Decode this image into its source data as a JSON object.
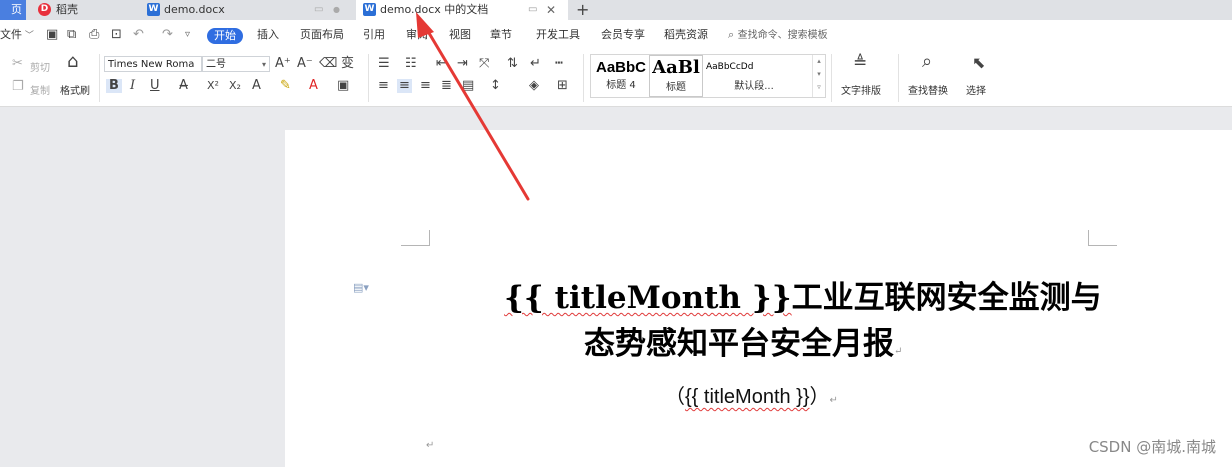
{
  "tabs": [
    {
      "label": "页",
      "icon": "home-icon"
    },
    {
      "label": "稻壳",
      "icon": "docer-icon"
    },
    {
      "label": "demo.docx",
      "icon": "word-doc-icon"
    },
    {
      "label": "demo.docx 中的文档",
      "icon": "word-doc-icon"
    }
  ],
  "menu": {
    "file": "文件",
    "start": "开始",
    "items": [
      "插入",
      "页面布局",
      "引用",
      "审阅",
      "视图",
      "章节",
      "开发工具",
      "会员专享",
      "稻壳资源"
    ],
    "search_placeholder": "查找命令、搜索模板"
  },
  "ribbon": {
    "cut": "剪切",
    "copy": "复制",
    "format_painter": "格式刷",
    "font_name": "Times New Roma",
    "font_size": "二号",
    "styles": [
      {
        "preview": "AaBbC",
        "name": "标题 4"
      },
      {
        "preview": "AaBl",
        "name": "标题"
      },
      {
        "preview": "AaBbCcDd",
        "name": "默认段..."
      }
    ],
    "text_layout": "文字排版",
    "find_replace": "查找替换",
    "select": "选择"
  },
  "document": {
    "title_placeholder": "{{ titleMonth }}",
    "title_rest": "工业互联网安全监测与",
    "title_line2": "态势感知平台安全月报",
    "subtitle_open": "（",
    "subtitle_placeholder": "{{ titleMonth }}",
    "subtitle_close": "）"
  },
  "watermark": "CSDN @南城.南城",
  "colors": {
    "accent": "#2f6de1",
    "arrow": "#e53935",
    "tabbar": "#dfe1e5",
    "workspace": "#e9eaed"
  }
}
